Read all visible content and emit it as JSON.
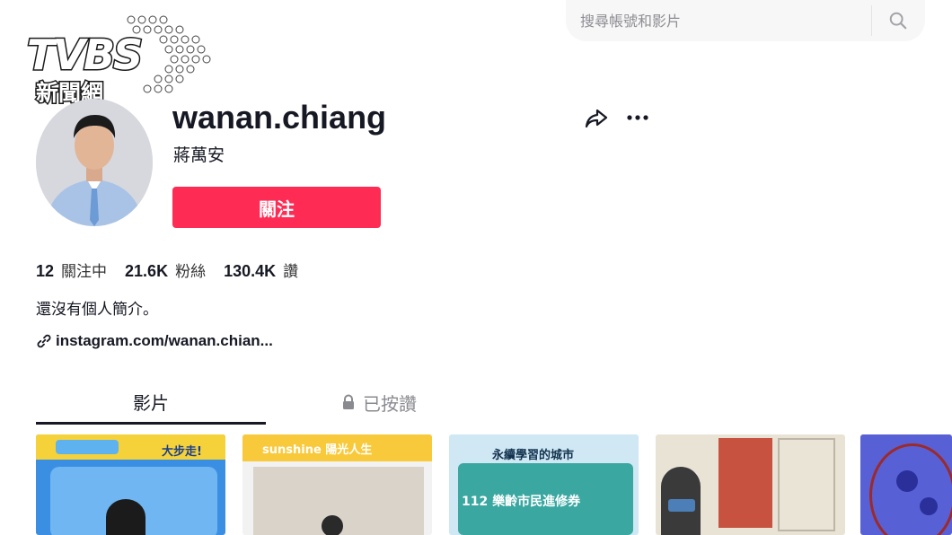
{
  "watermark": {
    "brand": "TVBS",
    "sub": "新聞網"
  },
  "search": {
    "placeholder": "搜尋帳號和影片"
  },
  "profile": {
    "username": "wanan.chiang",
    "nickname": "蔣萬安",
    "follow_label": "關注",
    "following_count": "12",
    "following_label": "關注中",
    "followers_count": "21.6K",
    "followers_label": "粉絲",
    "likes_count": "130.4K",
    "likes_label": "讚",
    "bio": "還沒有個人簡介。",
    "link": "instagram.com/wanan.chian..."
  },
  "tabs": [
    {
      "label": "影片",
      "active": true
    },
    {
      "label": "已按讚",
      "active": false
    }
  ],
  "videos": [
    {
      "caption": "大步走!"
    },
    {
      "caption": "sunshine 陽光人生"
    },
    {
      "caption": "永續學習的城市",
      "caption2": "112 樂齡市民進修券"
    },
    {
      "caption": ""
    },
    {
      "caption": ""
    }
  ],
  "colors": {
    "accent": "#fe2c55",
    "text": "#161823",
    "muted": "#8a8b91"
  }
}
